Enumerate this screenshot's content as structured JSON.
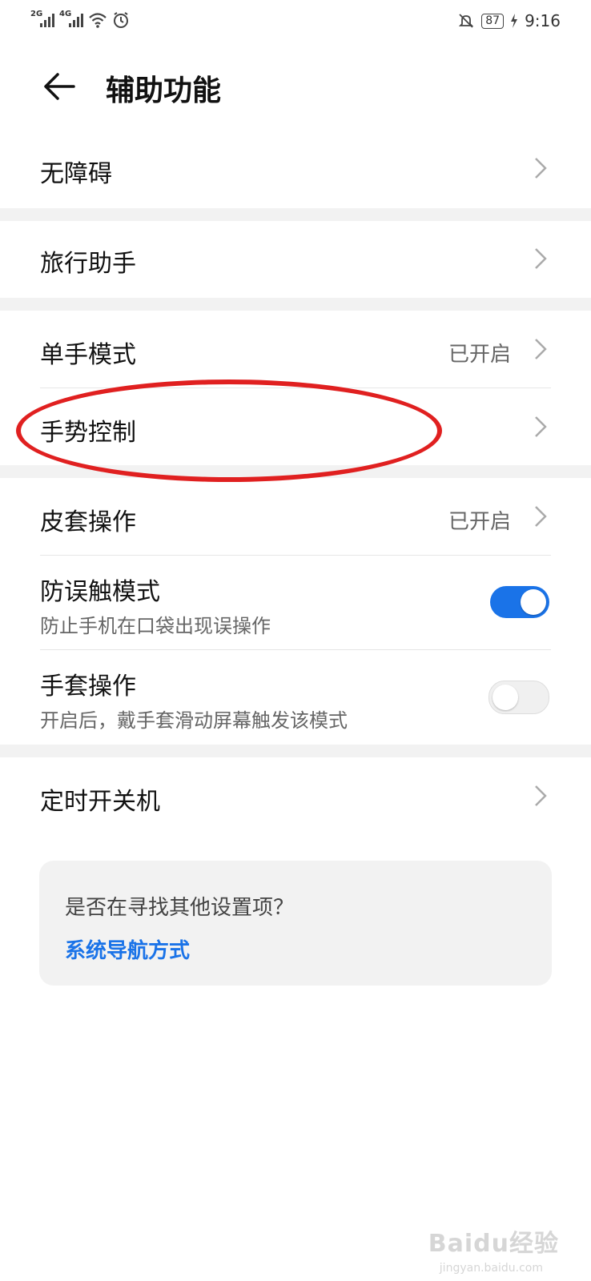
{
  "status_bar": {
    "sim1_network": "2G",
    "sim2_network": "4G",
    "battery": "87",
    "time": "9:16",
    "icons": [
      "signal-icon",
      "signal-icon",
      "wifi-icon",
      "alarm-icon",
      "mute-bell-icon",
      "battery-icon",
      "charging-icon"
    ]
  },
  "header": {
    "title": "辅助功能",
    "back_icon": "arrow-left-icon"
  },
  "groups": [
    {
      "items": [
        {
          "label": "无障碍"
        }
      ]
    },
    {
      "items": [
        {
          "label": "旅行助手"
        }
      ]
    },
    {
      "items": [
        {
          "label": "单手模式",
          "value": "已开启"
        },
        {
          "label": "手势控制",
          "highlighted": true
        }
      ]
    },
    {
      "items": [
        {
          "label": "皮套操作",
          "value": "已开启"
        },
        {
          "label": "防误触模式",
          "subtitle": "防止手机在口袋出现误操作",
          "toggle": true
        },
        {
          "label": "手套操作",
          "subtitle": "开启后，戴手套滑动屏幕触发该模式",
          "toggle": false
        }
      ]
    },
    {
      "items": [
        {
          "label": "定时开关机"
        }
      ]
    }
  ],
  "suggestion_card": {
    "question": "是否在寻找其他设置项？",
    "link": "系统导航方式"
  },
  "watermark": {
    "text": "Baidu经验",
    "url": "jingyan.baidu.com"
  },
  "colors": {
    "accent": "#1a73e8",
    "highlight_circle": "#e02020",
    "separator": "#f2f2f2"
  }
}
